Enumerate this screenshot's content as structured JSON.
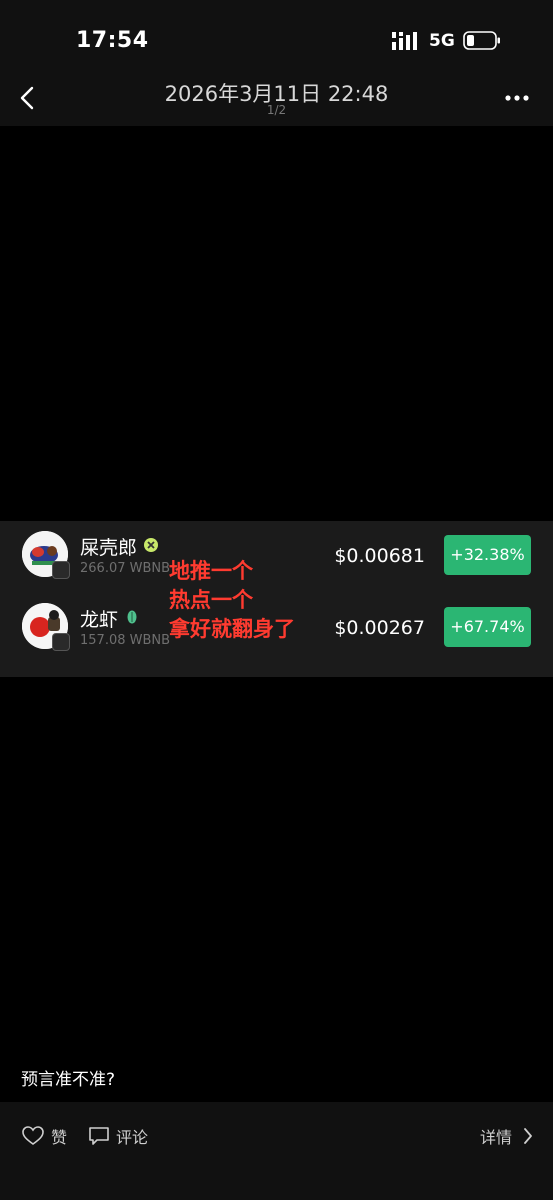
{
  "status_bar": {
    "time": "17:54",
    "network": "5G"
  },
  "nav": {
    "title": "2026年3月11日 22:48",
    "page_indicator": "1/2"
  },
  "tokens": [
    {
      "name": "屎壳郎",
      "amount": "266.07 WBNB",
      "price": "$0.00681",
      "change": "+32.38%"
    },
    {
      "name": "龙虾",
      "amount": "157.08 WBNB",
      "price": "$0.00267",
      "change": "+67.74%"
    }
  ],
  "overlay_text": [
    "地推一个",
    "热点一个",
    "拿好就翻身了"
  ],
  "caption": "预言准不准?",
  "bottom_bar": {
    "like_label": "赞",
    "comment_label": "评论",
    "details_label": "详情"
  },
  "colors": {
    "positive": "#2bb673",
    "annotation": "#ff3b30",
    "background": "#000000"
  }
}
